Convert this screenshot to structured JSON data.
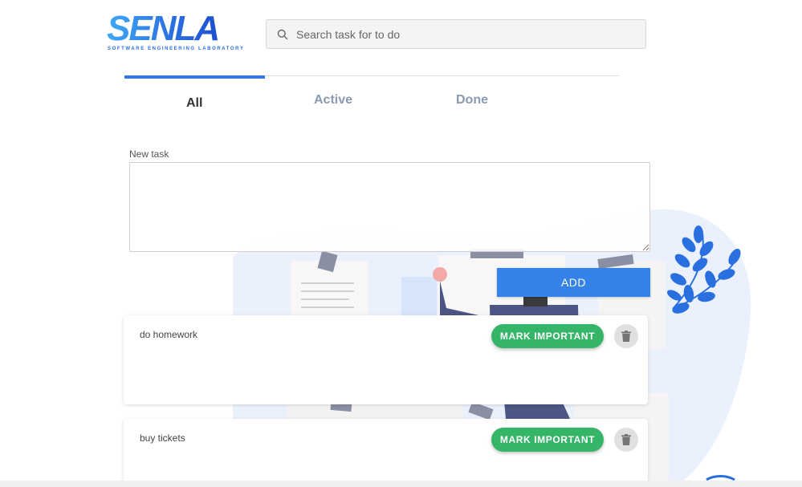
{
  "brand": {
    "logo_text": "SENLA",
    "logo_subtitle": "SOFTWARE ENGINEERING LABORATORY",
    "colors": {
      "primary": "#3578e5",
      "logo_light": "#3fa9f5",
      "logo_dark": "#1e4fcf"
    }
  },
  "search": {
    "placeholder": "Search task for to do",
    "value": "",
    "icon": "search-icon"
  },
  "tabs": [
    {
      "label": "All",
      "selected": true
    },
    {
      "label": "Active",
      "selected": false
    },
    {
      "label": "Done",
      "selected": false
    }
  ],
  "new_task": {
    "label": "New task",
    "value": "",
    "add_label": "ADD",
    "add_color": "#3582e8"
  },
  "tasks": [
    {
      "text": "do homework",
      "mark_label": "MARK IMPORTANT",
      "delete_icon": "trash-icon"
    },
    {
      "text": "buy tickets",
      "mark_label": "MARK IMPORTANT",
      "delete_icon": "trash-icon"
    }
  ],
  "colors": {
    "mark_important": "#35b567",
    "delete_bg": "#e0e0e0",
    "tab_inactive": "#8a9ab0",
    "illustration_bg": "#eaf1fc",
    "leaf": "#2a6fe0"
  }
}
